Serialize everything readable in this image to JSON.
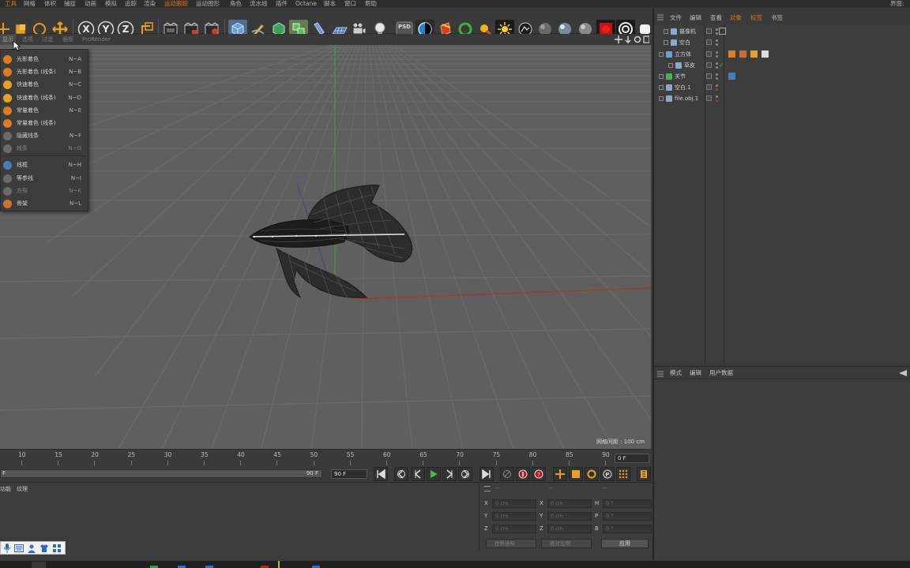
{
  "menubar": {
    "items": [
      {
        "label": "工具",
        "highlight": true
      },
      {
        "label": "网格",
        "highlight": false
      },
      {
        "label": "体积",
        "highlight": false
      },
      {
        "label": "捕捉",
        "highlight": false
      },
      {
        "label": "动画",
        "highlight": false
      },
      {
        "label": "模拟",
        "highlight": false
      },
      {
        "label": "追踪",
        "highlight": false
      },
      {
        "label": "渲染",
        "highlight": false
      },
      {
        "label": "运动跟踪",
        "highlight": true
      },
      {
        "label": "运动图形",
        "highlight": false
      },
      {
        "label": "角色",
        "highlight": false
      },
      {
        "label": "流水线",
        "highlight": false
      },
      {
        "label": "插件",
        "highlight": false
      },
      {
        "label": "Octane",
        "highlight": false
      },
      {
        "label": "脚本",
        "highlight": false
      },
      {
        "label": "窗口",
        "highlight": false
      },
      {
        "label": "帮助",
        "highlight": false
      }
    ],
    "right_label": "界面:"
  },
  "toolbar": {
    "axis_x": "X",
    "axis_y": "Y",
    "axis_z": "Z",
    "psd_label": "PSD"
  },
  "viewport": {
    "menus": [
      "显示",
      "选项",
      "过滤",
      "面板",
      "ProRender"
    ],
    "grid_spacing": "网格间距 : 100 cm"
  },
  "shading_menu": {
    "items": [
      {
        "label": "光影着色",
        "key": "N~A",
        "icon_color": "#e07a20",
        "dim": false
      },
      {
        "label": "光影着色 (线条)",
        "key": "N~B",
        "icon_color": "#e07a20",
        "dim": false
      },
      {
        "label": "快速着色",
        "key": "N~C",
        "icon_color": "#e8a020",
        "dim": false
      },
      {
        "label": "快速着色 (线条)",
        "key": "N~D",
        "icon_color": "#e8a020",
        "dim": false
      },
      {
        "label": "常量着色",
        "key": "N~E",
        "icon_color": "#e07a20",
        "dim": false
      },
      {
        "label": "常量着色 (线条)",
        "key": "",
        "icon_color": "#e07a20",
        "dim": false
      },
      {
        "label": "隐藏线条",
        "key": "N~F",
        "icon_color": "#6a6a6a",
        "dim": false
      },
      {
        "label": "线条",
        "key": "N~G",
        "icon_color": "#6a6a6a",
        "dim": true
      },
      {
        "label": "线框",
        "key": "N~H",
        "icon_color": "#4a7ab8",
        "dim": false
      },
      {
        "label": "等参线",
        "key": "N~I",
        "icon_color": "#6a6a6a",
        "dim": false
      },
      {
        "label": "方形",
        "key": "N~K",
        "icon_color": "#6a6a6a",
        "dim": true
      },
      {
        "label": "骨架",
        "key": "N~L",
        "icon_color": "#d07030",
        "dim": false
      }
    ]
  },
  "timeline": {
    "ticks": [
      "10",
      "15",
      "20",
      "25",
      "30",
      "35",
      "40",
      "45",
      "50",
      "55",
      "60",
      "65",
      "70",
      "75",
      "80",
      "85",
      "90"
    ],
    "current_frame": "0 F",
    "range_start": "F",
    "range_end": "90 F",
    "end_frame": "90 F"
  },
  "material_panel": {
    "tabs": [
      "功能",
      "纹理"
    ]
  },
  "coord_panel": {
    "headers": [
      "--",
      "--",
      "--"
    ],
    "rows": [
      {
        "l1": "X",
        "v1": "0 cm",
        "l2": "X",
        "v2": "0 cm",
        "l3": "H",
        "v3": "0 °"
      },
      {
        "l1": "Y",
        "v1": "0 cm",
        "l2": "Y",
        "v2": "0 cm",
        "l3": "P",
        "v3": "0 °"
      },
      {
        "l1": "Z",
        "v1": "0 cm",
        "l2": "Z",
        "v2": "0 cm",
        "l3": "B",
        "v3": "0 °"
      }
    ],
    "coord_system": "世界坐标",
    "scale_mode": "绝对比例",
    "apply": "应用"
  },
  "object_manager": {
    "tabs": [
      {
        "label": "文件",
        "active": false
      },
      {
        "label": "编辑",
        "active": false
      },
      {
        "label": "查看",
        "active": false
      },
      {
        "label": "对象",
        "active": true
      },
      {
        "label": "标签",
        "active": true
      },
      {
        "label": "书签",
        "active": false
      }
    ],
    "objects": [
      {
        "name": "摄像机",
        "indent": 1
      },
      {
        "name": "空白",
        "indent": 1
      },
      {
        "name": "立方体",
        "indent": 0
      },
      {
        "name": "草皮",
        "indent": 2
      },
      {
        "name": "关节",
        "indent": 0
      },
      {
        "name": "空白.1",
        "indent": 0
      },
      {
        "name": "file.obj.1",
        "indent": 0
      }
    ]
  },
  "attribute_manager": {
    "tabs": [
      "模式",
      "编辑",
      "用户数据"
    ]
  }
}
